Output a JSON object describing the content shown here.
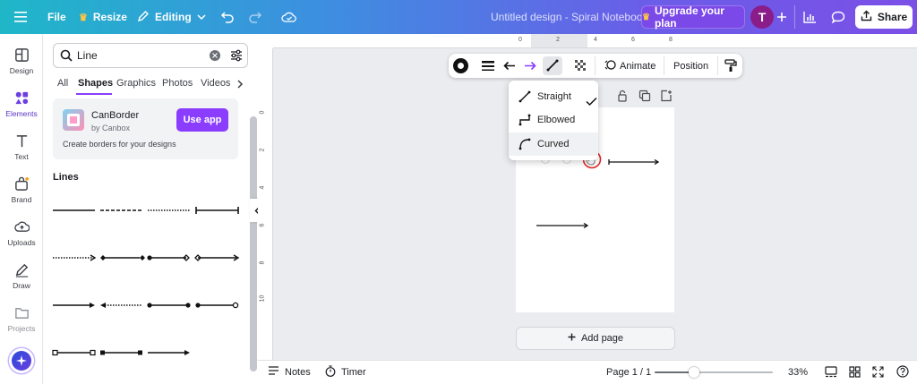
{
  "topbar": {
    "file_label": "File",
    "resize_label": "Resize",
    "editing_label": "Editing",
    "doc_title": "Untitled design - Spiral Notebook",
    "upgrade_label": "Upgrade your plan",
    "avatar_letter": "T",
    "share_label": "Share"
  },
  "rail": {
    "items": [
      {
        "label": "Design",
        "icon": "layout-icon"
      },
      {
        "label": "Elements",
        "icon": "elements-icon"
      },
      {
        "label": "Text",
        "icon": "text-icon"
      },
      {
        "label": "Brand",
        "icon": "brand-icon"
      },
      {
        "label": "Uploads",
        "icon": "cloud-upload-icon"
      },
      {
        "label": "Draw",
        "icon": "pen-icon"
      },
      {
        "label": "Projects",
        "icon": "folder-icon"
      }
    ]
  },
  "panel": {
    "search_value": "Line",
    "tabs": [
      "All",
      "Shapes",
      "Graphics",
      "Photos",
      "Videos"
    ],
    "active_tab": "Shapes",
    "app_card": {
      "name": "CanBorder",
      "by": "by Canbox",
      "cta": "Use app",
      "desc": "Create borders for your designs"
    },
    "section_title": "Lines"
  },
  "ruler": {
    "top_ticks": [
      "0",
      "2",
      "4",
      "6",
      "8"
    ],
    "left_ticks": [
      "0",
      "2",
      "4",
      "6",
      "8",
      "10"
    ]
  },
  "toolbar": {
    "animate_label": "Animate",
    "position_label": "Position"
  },
  "line_type_menu": {
    "items": [
      "Straight",
      "Elbowed",
      "Curved"
    ],
    "selected": "Straight"
  },
  "canvas": {
    "add_page_label": "Add page"
  },
  "bottombar": {
    "notes_label": "Notes",
    "timer_label": "Timer",
    "page_indicator": "Page 1 / 1",
    "zoom_label": "33%",
    "zoom_fraction": 0.33
  },
  "colors": {
    "accent": "#8b3dff",
    "avatar_bg": "#8a1d8a",
    "upgrade_bg": "#7a49e8",
    "selection_red": "#e0262a"
  }
}
